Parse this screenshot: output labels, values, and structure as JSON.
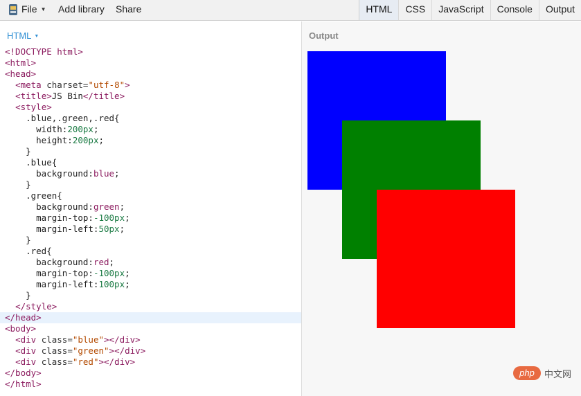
{
  "toolbar": {
    "file_label": "File",
    "add_library_label": "Add library",
    "share_label": "Share",
    "panels": [
      "HTML",
      "CSS",
      "JavaScript",
      "Console",
      "Output"
    ],
    "active_panel": "HTML"
  },
  "editor": {
    "label": "HTML",
    "highlighted_line": 24,
    "lines": [
      [
        [
          "tag",
          "<!DOCTYPE html>"
        ]
      ],
      [
        [
          "tag",
          "<html>"
        ]
      ],
      [
        [
          "tag",
          "<head>"
        ]
      ],
      [
        [
          "plain",
          "  "
        ],
        [
          "tag",
          "<meta "
        ],
        [
          "attr",
          "charset="
        ],
        [
          "str",
          "\"utf-8\""
        ],
        [
          "tag",
          ">"
        ]
      ],
      [
        [
          "plain",
          "  "
        ],
        [
          "tag",
          "<title>"
        ],
        [
          "plain",
          "JS Bin"
        ],
        [
          "tag",
          "</title>"
        ]
      ],
      [
        [
          "plain",
          "  "
        ],
        [
          "tag",
          "<style>"
        ]
      ],
      [
        [
          "plain",
          "    .blue,.green,.red{"
        ]
      ],
      [
        [
          "plain",
          "      width:"
        ],
        [
          "num",
          "200px"
        ],
        [
          "plain",
          ";"
        ]
      ],
      [
        [
          "plain",
          "      height:"
        ],
        [
          "num",
          "200px"
        ],
        [
          "plain",
          ";"
        ]
      ],
      [
        [
          "plain",
          "    }"
        ]
      ],
      [
        [
          "plain",
          "    .blue{"
        ]
      ],
      [
        [
          "plain",
          "      background:"
        ],
        [
          "kw",
          "blue"
        ],
        [
          "plain",
          ";"
        ]
      ],
      [
        [
          "plain",
          "    }"
        ]
      ],
      [
        [
          "plain",
          "    .green{"
        ]
      ],
      [
        [
          "plain",
          "      background:"
        ],
        [
          "kw",
          "green"
        ],
        [
          "plain",
          ";"
        ]
      ],
      [
        [
          "plain",
          "      margin-top:"
        ],
        [
          "num",
          "-100px"
        ],
        [
          "plain",
          ";"
        ]
      ],
      [
        [
          "plain",
          "      margin-left:"
        ],
        [
          "num",
          "50px"
        ],
        [
          "plain",
          ";"
        ]
      ],
      [
        [
          "plain",
          "    }"
        ]
      ],
      [
        [
          "plain",
          "    .red{"
        ]
      ],
      [
        [
          "plain",
          "      background:"
        ],
        [
          "kw",
          "red"
        ],
        [
          "plain",
          ";"
        ]
      ],
      [
        [
          "plain",
          "      margin-top:"
        ],
        [
          "num",
          "-100px"
        ],
        [
          "plain",
          ";"
        ]
      ],
      [
        [
          "plain",
          "      margin-left:"
        ],
        [
          "num",
          "100px"
        ],
        [
          "plain",
          ";"
        ]
      ],
      [
        [
          "plain",
          "    }"
        ]
      ],
      [
        [
          "plain",
          "  "
        ],
        [
          "tag",
          "</style>"
        ]
      ],
      [
        [
          "tag",
          "</head>"
        ]
      ],
      [
        [
          "tag",
          "<body>"
        ]
      ],
      [
        [
          "plain",
          "  "
        ],
        [
          "tag",
          "<div "
        ],
        [
          "attr",
          "class="
        ],
        [
          "str",
          "\"blue\""
        ],
        [
          "tag",
          "></div>"
        ]
      ],
      [
        [
          "plain",
          "  "
        ],
        [
          "tag",
          "<div "
        ],
        [
          "attr",
          "class="
        ],
        [
          "str",
          "\"green\""
        ],
        [
          "tag",
          "></div>"
        ]
      ],
      [
        [
          "plain",
          "  "
        ],
        [
          "tag",
          "<div "
        ],
        [
          "attr",
          "class="
        ],
        [
          "str",
          "\"red\""
        ],
        [
          "tag",
          "></div>"
        ]
      ],
      [
        [
          "tag",
          "</body>"
        ]
      ],
      [
        [
          "tag",
          "</html>"
        ]
      ]
    ]
  },
  "output": {
    "label": "Output",
    "boxes": [
      {
        "name": "blue",
        "color": "#0000ff"
      },
      {
        "name": "green",
        "color": "#008000"
      },
      {
        "name": "red",
        "color": "#ff0000"
      }
    ]
  },
  "watermark": {
    "badge": "php",
    "text": "中文网"
  },
  "colors": {
    "tag": "#8b1a5e",
    "string": "#b34a00",
    "number": "#1a7a43",
    "accent": "#2f8fd4"
  }
}
